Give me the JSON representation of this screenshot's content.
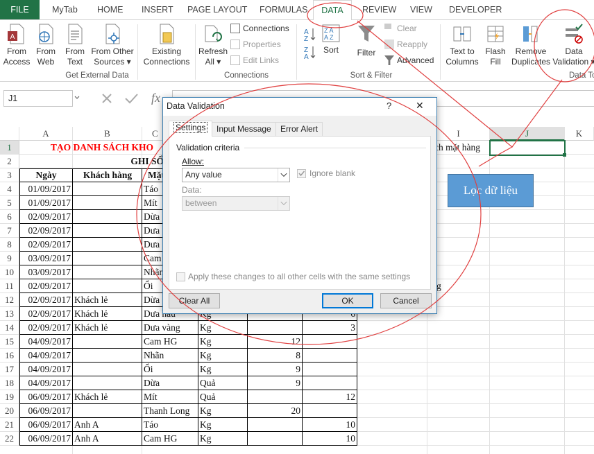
{
  "tabs": [
    "FILE",
    "MyTab",
    "HOME",
    "INSERT",
    "PAGE LAYOUT",
    "FORMULAS",
    "DATA",
    "REVIEW",
    "VIEW",
    "DEVELOPER"
  ],
  "ribbon": {
    "from_access": [
      "From",
      "Access"
    ],
    "from_web": [
      "From",
      "Web"
    ],
    "from_text": [
      "From",
      "Text"
    ],
    "from_other": [
      "From Other",
      "Sources ▾"
    ],
    "existing": [
      "Existing",
      "Connections"
    ],
    "group_external": "Get External Data",
    "refresh": [
      "Refresh",
      "All ▾"
    ],
    "connections": "Connections",
    "properties": "Properties",
    "edit_links": "Edit Links",
    "group_connections": "Connections",
    "sort": "Sort",
    "filter": "Filter",
    "clear": "Clear",
    "reapply": "Reapply",
    "advanced": "Advanced",
    "group_sort": "Sort & Filter",
    "text_to_columns": [
      "Text to",
      "Columns"
    ],
    "flash_fill": [
      "Flash",
      "Fill"
    ],
    "remove_dup": [
      "Remove",
      "Duplicates"
    ],
    "data_validation": [
      "Data",
      "Validation ▾"
    ],
    "group_datatools": "Data To"
  },
  "name_box": "J1",
  "fx": "fx",
  "columns": [
    "A",
    "B",
    "C",
    "I",
    "J",
    "K"
  ],
  "rows": [
    "1",
    "2",
    "3",
    "4",
    "5",
    "6",
    "7",
    "8",
    "9",
    "10",
    "11",
    "12",
    "13",
    "14",
    "15",
    "16",
    "17",
    "18",
    "19",
    "20",
    "21",
    "22"
  ],
  "title": "TẠO DANH SÁCH KHO",
  "subtitle": "GHI SỔ",
  "header": {
    "ngay": "Ngày",
    "khach": "Khách hàng",
    "mat": "Mặt"
  },
  "i1_text": "ách mặt hàng",
  "i11_text": "g",
  "loc_button": "Lọc dữ liệu",
  "table": [
    {
      "d": "01/09/2017",
      "k": "",
      "m": "Táo",
      "u": "",
      "q": "",
      "e": ""
    },
    {
      "d": "01/09/2017",
      "k": "",
      "m": "Mít",
      "u": "",
      "q": "",
      "e": ""
    },
    {
      "d": "02/09/2017",
      "k": "",
      "m": "Dừa",
      "u": "",
      "q": "",
      "e": ""
    },
    {
      "d": "02/09/2017",
      "k": "",
      "m": "Dưa",
      "u": "",
      "q": "",
      "e": ""
    },
    {
      "d": "02/09/2017",
      "k": "",
      "m": "Dưa",
      "u": "",
      "q": "",
      "e": ""
    },
    {
      "d": "03/09/2017",
      "k": "",
      "m": "Cam",
      "u": "",
      "q": "",
      "e": ""
    },
    {
      "d": "03/09/2017",
      "k": "",
      "m": "Nhãn",
      "u": "",
      "q": "",
      "e": ""
    },
    {
      "d": "02/09/2017",
      "k": "",
      "m": "Ổi",
      "u": "",
      "q": "",
      "e": ""
    },
    {
      "d": "02/09/2017",
      "k": "Khách lẻ",
      "m": "Dừa",
      "u": "",
      "q": "",
      "e": ""
    },
    {
      "d": "02/09/2017",
      "k": "Khách lẻ",
      "m": "Dưa hấu",
      "u": "Kg",
      "q": "",
      "e": "6"
    },
    {
      "d": "02/09/2017",
      "k": "Khách lẻ",
      "m": "Dưa vàng",
      "u": "Kg",
      "q": "",
      "e": "3"
    },
    {
      "d": "04/09/2017",
      "k": "",
      "m": "Cam HG",
      "u": "Kg",
      "q": "12",
      "e": ""
    },
    {
      "d": "04/09/2017",
      "k": "",
      "m": "Nhãn",
      "u": "Kg",
      "q": "8",
      "e": ""
    },
    {
      "d": "04/09/2017",
      "k": "",
      "m": "Ổi",
      "u": "Kg",
      "q": "9",
      "e": ""
    },
    {
      "d": "04/09/2017",
      "k": "",
      "m": "Dừa",
      "u": "Quả",
      "q": "9",
      "e": ""
    },
    {
      "d": "06/09/2017",
      "k": "Khách lẻ",
      "m": "Mít",
      "u": "Quả",
      "q": "",
      "e": "12"
    },
    {
      "d": "06/09/2017",
      "k": "",
      "m": "Thanh Long",
      "u": "Kg",
      "q": "20",
      "e": ""
    },
    {
      "d": "06/09/2017",
      "k": "Anh A",
      "m": "Táo",
      "u": "Kg",
      "q": "",
      "e": "10"
    },
    {
      "d": "06/09/2017",
      "k": "Anh A",
      "m": "Cam HG",
      "u": "Kg",
      "q": "",
      "e": "10"
    }
  ],
  "dialog": {
    "title": "Data Validation",
    "help": "?",
    "close": "✕",
    "tabs": [
      "Settings",
      "Input Message",
      "Error Alert"
    ],
    "criteria": "Validation criteria",
    "allow_label": "Allow:",
    "allow_value": "Any value",
    "ignore_blank": "Ignore blank",
    "data_label": "Data:",
    "data_value": "between",
    "apply_all": "Apply these changes to all other cells with the same settings",
    "clear_all": "Clear All",
    "ok": "OK",
    "cancel": "Cancel"
  },
  "colors": {
    "excel_green": "#217346",
    "button_blue": "#5b9bd5",
    "annotation_red": "#e04040",
    "title_red": "#ff0000"
  }
}
